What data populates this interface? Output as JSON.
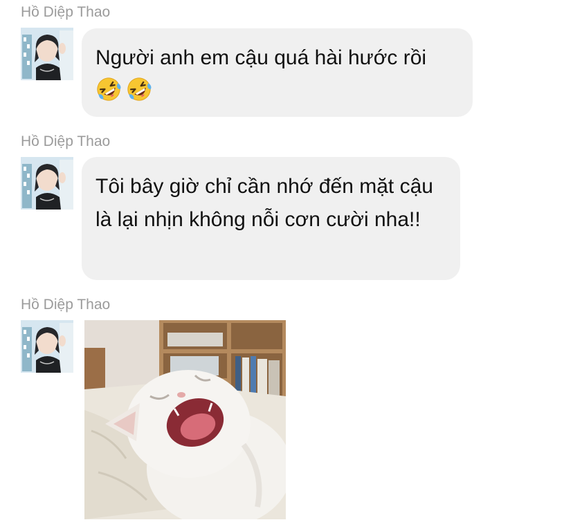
{
  "messages": [
    {
      "sender": "Hồ Diệp Thao",
      "text": "Người anh em cậu quá hài hước rồi",
      "emojis": [
        "rolling-on-floor-laughing",
        "rolling-on-floor-laughing"
      ]
    },
    {
      "sender": "Hồ Diệp Thao",
      "text": "Tôi bây giờ chỉ cần nhớ đến mặt cậu là lại nhịn không nỗi cơn cười nha!!"
    },
    {
      "sender": "Hồ Diệp Thao",
      "attachment": "image"
    }
  ]
}
